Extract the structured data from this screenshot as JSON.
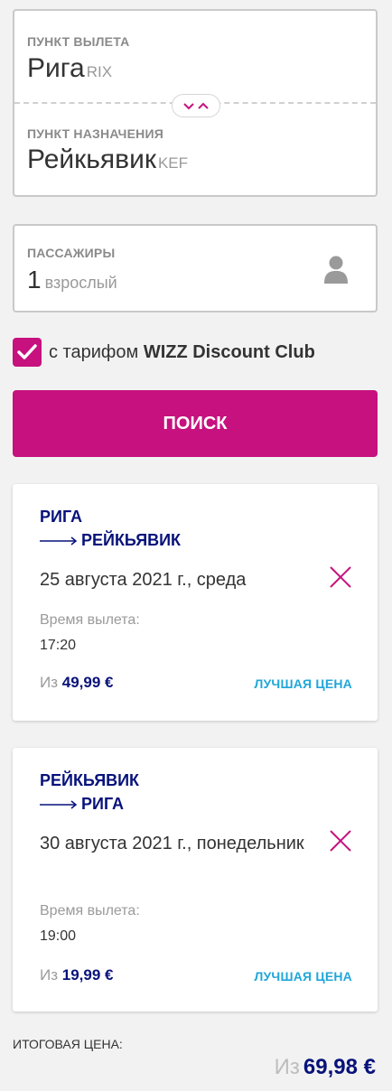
{
  "origin": {
    "label": "ПУНКТ ВЫЛЕТА",
    "city": "Рига",
    "code": "RIX"
  },
  "destination": {
    "label": "ПУНКТ НАЗНАЧЕНИЯ",
    "city": "Рейкьявик",
    "code": "KEF"
  },
  "passengers": {
    "label": "ПАССАЖИРЫ",
    "count": "1",
    "unit": "взрослый"
  },
  "discount": {
    "prefix": "с тарифом",
    "club": "WIZZ Discount Club",
    "checked": true
  },
  "search": {
    "label": "ПОИСК"
  },
  "flights": [
    {
      "from": "РИГА",
      "to": "РЕЙКЬЯВИК",
      "date": "25 августа 2021 г., среда",
      "dep_label": "Время вылета:",
      "dep_time": "17:20",
      "price_prefix": "Из",
      "price": "49,99 €",
      "badge": "ЛУЧШАЯ ЦЕНА"
    },
    {
      "from": "РЕЙКЬЯВИК",
      "to": "РИГА",
      "date": "30 августа 2021 г., понедельник",
      "dep_label": "Время вылета:",
      "dep_time": "19:00",
      "price_prefix": "Из",
      "price": "19,99 €",
      "badge": "ЛУЧШАЯ ЦЕНА"
    }
  ],
  "total": {
    "label": "ИТОГОВАЯ ЦЕНА:",
    "prefix": "Из",
    "price": "69,98 €"
  },
  "colors": {
    "brand": "#c6117e",
    "navy": "#07127a",
    "best_price": "#20a6d8"
  },
  "icons": [
    "swap-chevrons-icon",
    "person-icon",
    "checkmark-icon",
    "arrow-right-icon",
    "close-icon"
  ]
}
